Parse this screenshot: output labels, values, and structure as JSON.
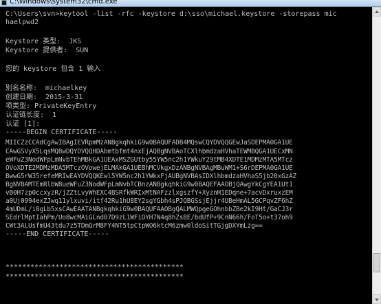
{
  "window": {
    "title": "C:\\Windows\\system32\\cmd.exe",
    "icon": "console-icon"
  },
  "console": {
    "lines": [
      "C:\\Users\\svn>keytool -list -rfc -keystore d:\\sso\\michael.keystore -storepass mic",
      "haelpwd2",
      "",
      "Keystore 类型:  JKS",
      "Keystore 提供者:  SUN",
      "",
      "您的 keystore 包含 1 输入",
      "",
      "别名名称:  michaelkey",
      "创建日期:  2015-3-31",
      "项类型: PrivateKeyEntry",
      "认证链长度:  1",
      "认证 [1]:",
      "-----BEGIN CERTIFICATE-----",
      "MIICZzCCAdCgAwIBAgIEVRpmMzANBgkqhkiG9w0BAQUFADB4MQswCQYDVQQGEwJaSDEPMA0GA1UE",
      "CAwGSVyX5LqsMQ8wDQYDVQQHDAbmtbfmt4nxEjAQBgNVBAoTCXlhbmdzaHVhaTEWMBQGA1UECxMN",
      "eWFuZ3NodWFpLmNvbTEhMBkGA1UEAxMSZGUtby55YW5nc2h1YWkuY29tMB4XDTE1MDMzMTA5MTcz",
      "OVoXDTE2MDMzMDA5MTczOVowejELMAkGA1UEBhMCVkgxDzANBgNVBAgMBuWM1+S6rDEPMA0GA1UE",
      "BwwG5rW35ref‌eMRIwEAYDVQQKEwl5YW5nc2h1YWkxFjAUBgNVBAsIDXlhbmdzaHVhaS5jb20xGzAZ",
      "BgNVBAMTEmRlbW8ueWFuZ3NodWFpLmNvbTCBnzANBgkqhkiG9w0BAQEFAAOBjQAwgYkCgYEA1Ut1",
      "vB0H7zp0ccxyzR/jZZtLvyWhEXC4BSRfkWRIxMtNAFzzlxgszfY+XyznH1EDqne+7acvDxruxzEM",
      "a0Uj0994exZJwq11ylxuvi/itf42Ru1hU8EY2sgYGbh4sPJQBGSsjEjjr4UBeHmAL5GCPqvZF6hZ",
      "4mUDmL/i0gLb5xsCAwEAATANBgkqhkiG9w0BAQUFAAOBgQALMWQpgeGOhnbbZBe2kI9Ht/GaCJ3r",
      "SEdrlMptIahPm/Uo8wcMAiGLnd07D9zL1WFiDYH7N4q8hZs8E/bdUfP+9CnN66h/FoT5o+t37oh9",
      "CWt3ALUsfmU43tdu7z5TDmQrM8FY4NT5tpCtpWO6ktcM6zmw0ldoSitTGjgDXYmLzg==",
      "-----END CERTIFICATE-----",
      "",
      "",
      "",
      "*******************************************",
      "*******************************************"
    ]
  },
  "scrollbar": {
    "up_icon": "arrow-up-icon",
    "down_icon": "arrow-down-icon"
  }
}
